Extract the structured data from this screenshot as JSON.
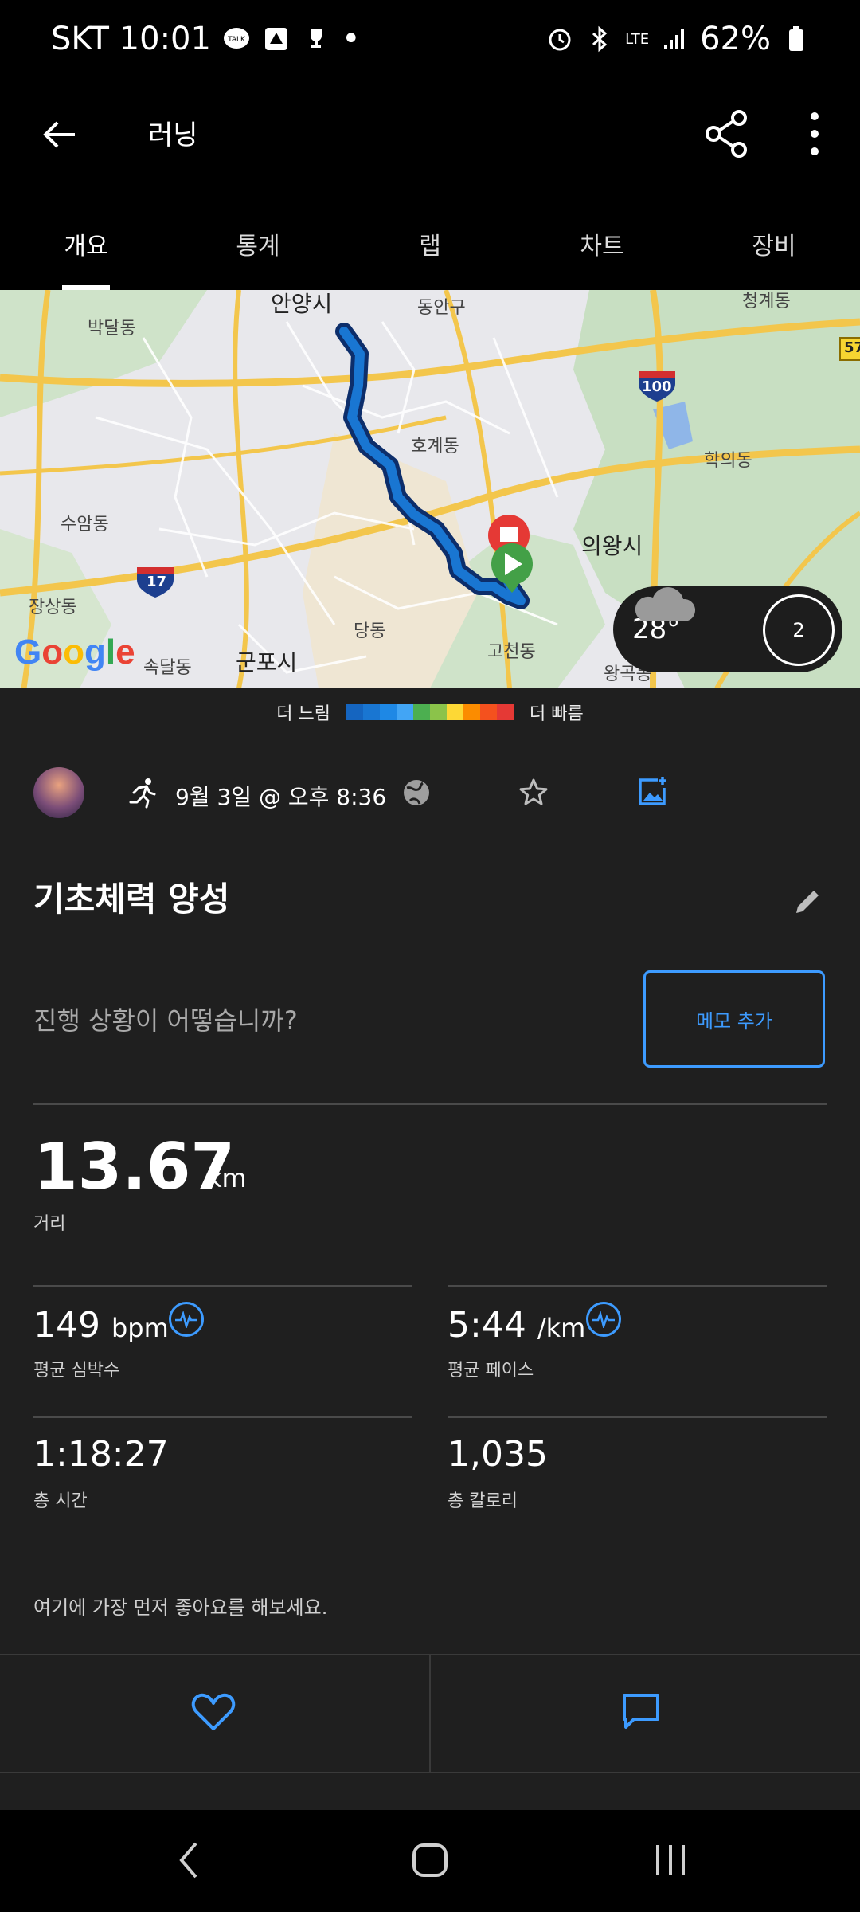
{
  "status_bar": {
    "carrier_time": "SKT 10:01",
    "dot": "•",
    "network": "LTE",
    "battery": "62%"
  },
  "app_bar": {
    "title": "러닝",
    "icons": [
      "back-arrow-icon",
      "share-icon",
      "more-vert-icon"
    ]
  },
  "tabs": [
    {
      "label": "개요",
      "active": true
    },
    {
      "label": "통계",
      "active": false
    },
    {
      "label": "랩",
      "active": false
    },
    {
      "label": "차트",
      "active": false
    },
    {
      "label": "장비",
      "active": false
    }
  ],
  "map": {
    "labels": {
      "nw_city": "안양시",
      "dongan": "동안구",
      "cheonggye": "청계동",
      "bakdal": "박달동",
      "hogye": "호계동",
      "hakui": "학의동",
      "uiwang": "의왕시",
      "suam": "수암동",
      "jangsang": "장상동",
      "sokdal": "속달동",
      "gunpo": "군포시",
      "dang": "당동",
      "gohyeon": "고천동",
      "wanggok": "왕곡동"
    },
    "route_shields": [
      "100",
      "17",
      "57"
    ],
    "google": "Google",
    "weather": {
      "temp": "28°",
      "icon": "cloud-icon",
      "lap_count": "2"
    }
  },
  "pace_legend": {
    "slower": "더 느림",
    "faster": "더 빠름",
    "colors": [
      "#1565c0",
      "#1976d2",
      "#1e88e5",
      "#42a5f5",
      "#4caf50",
      "#8bc34a",
      "#fdd835",
      "#fb8c00",
      "#f4511e",
      "#e53935"
    ]
  },
  "activity": {
    "type_icon": "running-icon",
    "date_text": "9월 3일 @ 오후 8:36",
    "title": "기초체력 양성",
    "status_question": "진행 상황이 어떻습니까?",
    "memo_button": "메모 추가"
  },
  "stats": {
    "distance": {
      "value": "13.67",
      "unit": "km",
      "label": "거리"
    },
    "avg_hr": {
      "value": "149",
      "unit": "bpm",
      "label": "평균 심박수"
    },
    "avg_pace": {
      "value": "5:44",
      "unit": "/km",
      "label": "평균 페이스"
    },
    "total_time": {
      "value": "1:18:27",
      "label": "총 시간"
    },
    "calories": {
      "value": "1,035",
      "label": "총 칼로리"
    }
  },
  "social": {
    "like_cta": "여기에 가장 먼저 좋아요를 해보세요."
  },
  "colors": {
    "accent": "#3d9bff",
    "background": "#1f1f1f",
    "route": "#1565c0"
  }
}
